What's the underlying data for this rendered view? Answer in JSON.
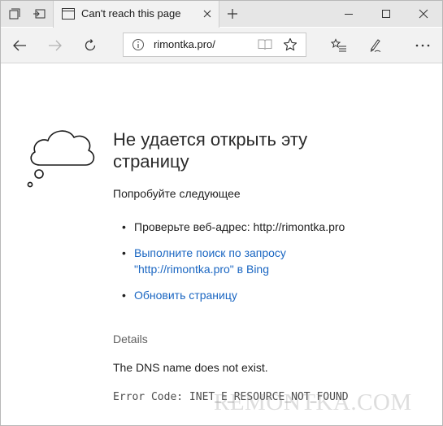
{
  "tab": {
    "title": "Can't reach this page"
  },
  "address_bar": {
    "url": "rimontka.pro/"
  },
  "error": {
    "title": "Не удается открыть эту страницу",
    "subtitle": "Попробуйте следующее",
    "suggestions": {
      "check_address": "Проверьте веб-адрес: http://rimontka.pro",
      "search_line1": "Выполните поиск по запросу",
      "search_line2": "\"http://rimontka.pro\" в Bing",
      "refresh": "Обновить страницу"
    },
    "details_label": "Details",
    "details_text": "The DNS name does not exist.",
    "error_code": "Error Code: INET_E_RESOURCE_NOT_FOUND"
  },
  "watermark": "REMONTKA.COM",
  "icons": {
    "tab_manager": "tabs-icon",
    "tab_back": "set-aside-icon",
    "tab_page": "page-icon",
    "tab_close": "close-icon",
    "new_tab": "plus-icon",
    "minimize": "minimize-icon",
    "maximize": "maximize-icon",
    "close_window": "close-icon",
    "back": "arrow-left-icon",
    "forward": "arrow-right-icon",
    "refresh": "refresh-icon",
    "info": "info-icon",
    "reading_view": "book-icon",
    "favorite": "star-icon",
    "favorites_hub": "favorites-list-icon",
    "web_note": "pen-icon",
    "more": "more-icon"
  },
  "colors": {
    "link": "#1a66c2",
    "tabbar": "#e6e6e6",
    "navbar": "#f2f2f2"
  }
}
